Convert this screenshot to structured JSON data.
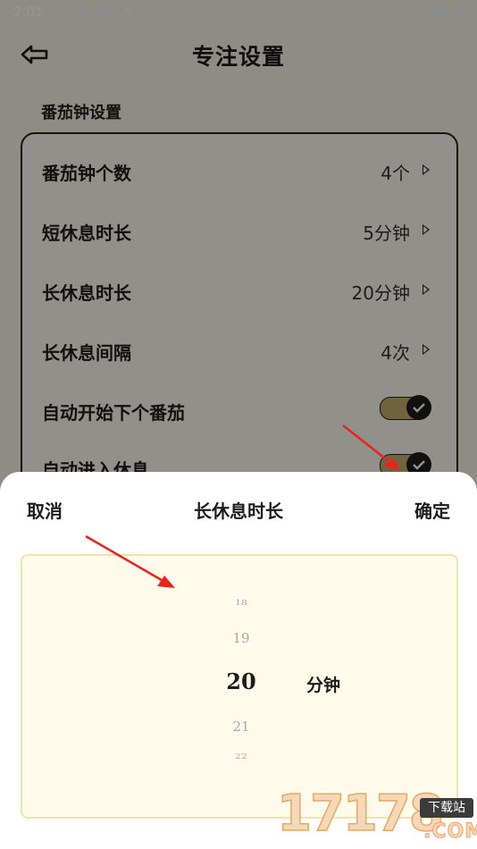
{
  "status_bar": {
    "time": "2:01",
    "icons": [
      "notification-icon",
      "notification-icon",
      "notification-icon",
      "a-icon"
    ],
    "square_label": "A"
  },
  "header": {
    "title": "专注设置",
    "back_icon": "back-arrow-icon"
  },
  "section": {
    "title": "番茄钟设置"
  },
  "settings": {
    "rows": [
      {
        "label": "番茄钟个数",
        "value": "4个"
      },
      {
        "label": "短休息时长",
        "value": "5分钟"
      },
      {
        "label": "长休息时长",
        "value": "20分钟"
      },
      {
        "label": "长休息间隔",
        "value": "4次"
      }
    ],
    "toggles": [
      {
        "label": "自动开始下个番茄",
        "on": true
      },
      {
        "label": "自动进入休息",
        "on": true
      }
    ]
  },
  "sheet": {
    "cancel_label": "取消",
    "title": "长休息时长",
    "confirm_label": "确定",
    "picker_values": [
      "18",
      "19",
      "20",
      "21",
      "22"
    ],
    "selected": "20",
    "unit": "分钟"
  },
  "watermark": {
    "number": "17178",
    "badge": "下载站",
    "domain": ".COM"
  },
  "colors": {
    "accent": "#c4ab6d",
    "annotation": "#e8241f",
    "picker_bg": "#fffaea"
  }
}
